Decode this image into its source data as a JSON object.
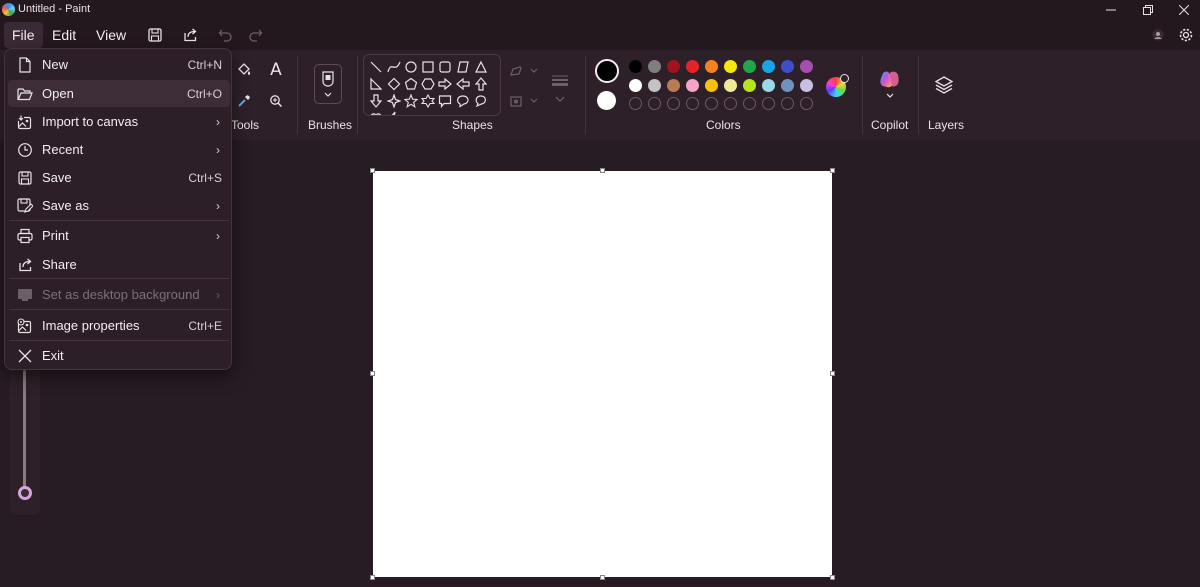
{
  "window": {
    "title": "Untitled - Paint",
    "minimize_icon": "minimize-icon",
    "maximize_icon": "restore-icon",
    "close_icon": "close-icon"
  },
  "menubar": {
    "file": "File",
    "edit": "Edit",
    "view": "View"
  },
  "ribbon": {
    "tools_label": "Tools",
    "brushes_label": "Brushes",
    "shapes_label": "Shapes",
    "colors_label": "Colors",
    "copilot_label": "Copilot",
    "layers_label": "Layers",
    "text_tool_glyph": "A"
  },
  "colors": {
    "primary": "#000000",
    "secondary": "#ffffff",
    "row1": [
      "#000000",
      "#7f7f7f",
      "#a3121f",
      "#e5232a",
      "#f58220",
      "#f5e60e",
      "#1fa84a",
      "#1aa3e8",
      "#3e4fc9",
      "#a24fb0"
    ],
    "row2": [
      "#ffffff",
      "#c3c3c3",
      "#b97a56",
      "#f5a3c8",
      "#f5c30f",
      "#eee89b",
      "#b5e61d",
      "#99d9ea",
      "#7092be",
      "#c8bfe7"
    ],
    "custom_slots": 10
  },
  "file_menu": {
    "items": [
      {
        "label": "New",
        "icon": "new-file-icon",
        "shortcut": "Ctrl+N"
      },
      {
        "label": "Open",
        "icon": "open-folder-icon",
        "shortcut": "Ctrl+O"
      },
      {
        "label": "Import to canvas",
        "icon": "import-image-icon",
        "submenu": true
      },
      {
        "label": "Recent",
        "icon": "clock-icon",
        "submenu": true
      },
      {
        "label": "Save",
        "icon": "save-icon",
        "shortcut": "Ctrl+S"
      },
      {
        "label": "Save as",
        "icon": "save-as-icon",
        "submenu": true
      },
      {
        "label": "Print",
        "icon": "printer-icon",
        "submenu": true
      },
      {
        "label": "Share",
        "icon": "share-icon"
      },
      {
        "label": "Set as desktop background",
        "icon": "desktop-background-icon",
        "submenu": true,
        "disabled": true
      },
      {
        "label": "Image properties",
        "icon": "image-properties-icon",
        "shortcut": "Ctrl+E"
      },
      {
        "label": "Exit",
        "icon": "exit-icon"
      }
    ]
  }
}
